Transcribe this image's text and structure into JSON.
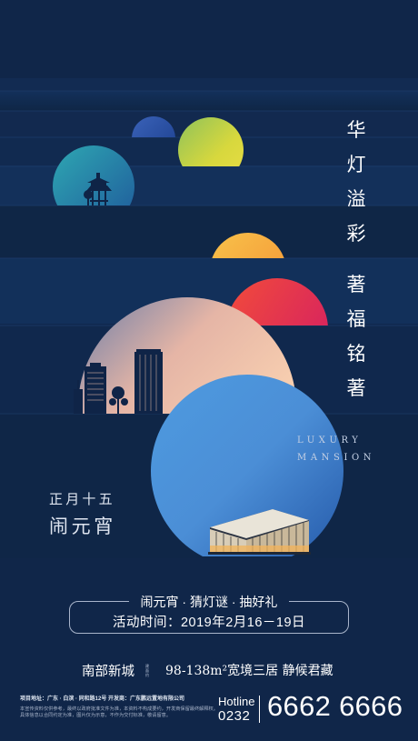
{
  "headline_top": [
    "华",
    "灯",
    "溢",
    "彩"
  ],
  "headline_bottom": [
    "著",
    "福",
    "铭",
    "著"
  ],
  "luxury_line1": "LUXURY",
  "luxury_line2": "MANSION",
  "festival_date": "正月十五",
  "festival_name": "闹元宵",
  "activities": "闹元宵 · 猜灯谜 · 抽好礼",
  "event_time": "活动时间：2019年2月16－19日",
  "district": "南部新城",
  "tiny_label": "建面约",
  "tagline": "98-138m²宽境三居  静候君藏",
  "project_address": "项目地址：广东 · 白滨 · 同和路12号  开发商：广东鹏远置地有限公司",
  "disclaimer_line1": "本宣传资料仅供参考，最终以政府批准文件为准，本资料不构成要约，开发商保留最终解释权。",
  "disclaimer_line2": "具体信息以合同约定为准，图片仅为示意，不作为交付标准，敬请留意。",
  "hotline_label": "Hotline",
  "hotline_area": "0232",
  "phone_number": "6662 6666",
  "colors": {
    "background": "#102649",
    "yellow_sun": "#cfd63f",
    "orange_sun": "#f7a93c",
    "red_sun": "#e53a4a",
    "blue_moon": "#4a8fd6",
    "peach_moon": "#f4c0a4"
  }
}
